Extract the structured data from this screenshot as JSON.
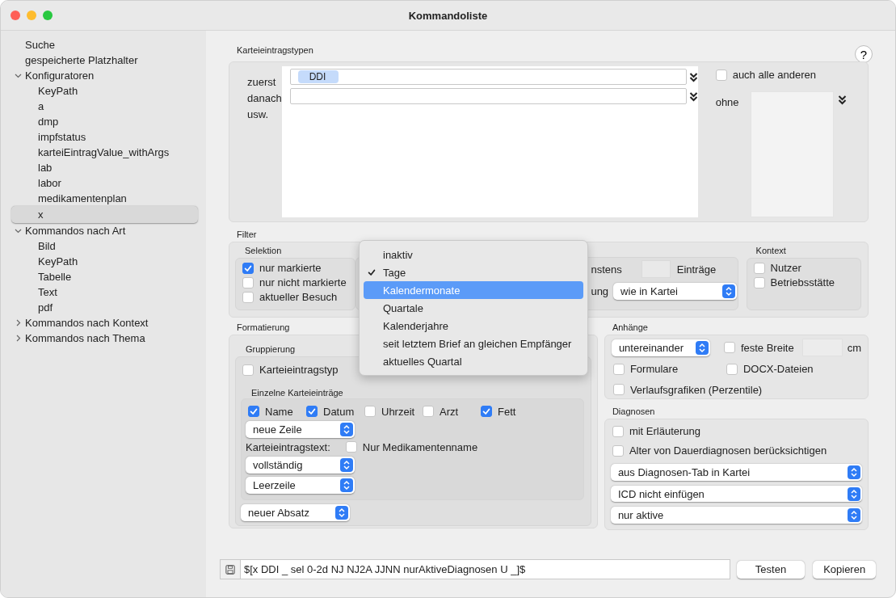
{
  "window": {
    "title": "Kommandoliste"
  },
  "sidebar": {
    "items": [
      {
        "kind": "leaf",
        "label": "Suche",
        "selected": false
      },
      {
        "kind": "leaf",
        "label": "gespeicherte Platzhalter",
        "selected": false
      },
      {
        "kind": "group",
        "label": "Konfiguratoren",
        "expanded": true,
        "selected": false,
        "children": [
          {
            "label": "KeyPath",
            "selected": false
          },
          {
            "label": "a",
            "selected": false
          },
          {
            "label": "dmp",
            "selected": false
          },
          {
            "label": "impfstatus",
            "selected": false
          },
          {
            "label": "karteiEintragValue_withArgs",
            "selected": false
          },
          {
            "label": "lab",
            "selected": false
          },
          {
            "label": "labor",
            "selected": false
          },
          {
            "label": "medikamentenplan",
            "selected": false
          },
          {
            "label": "x",
            "selected": true
          }
        ]
      },
      {
        "kind": "group",
        "label": "Kommandos nach Art",
        "expanded": true,
        "selected": false,
        "children": [
          {
            "label": "Bild",
            "selected": false
          },
          {
            "label": "KeyPath",
            "selected": false
          },
          {
            "label": "Tabelle",
            "selected": false
          },
          {
            "label": "Text",
            "selected": false
          },
          {
            "label": "pdf",
            "selected": false
          }
        ]
      },
      {
        "kind": "group",
        "label": "Kommandos nach Kontext",
        "expanded": false,
        "selected": false
      },
      {
        "kind": "group",
        "label": "Kommandos nach Thema",
        "expanded": false,
        "selected": false
      }
    ]
  },
  "help_button": {
    "label": "?"
  },
  "entry_types": {
    "title": "Karteieintragstypen",
    "row_labels": [
      "zuerst",
      "danach",
      "usw."
    ],
    "fields": [
      {
        "kind": "token",
        "token": "DDI"
      },
      {
        "kind": "empty"
      }
    ],
    "all_others": {
      "label": "auch alle anderen",
      "checked": false
    },
    "without_label": "ohne"
  },
  "filter": {
    "title": "Filter",
    "selection": {
      "title": "Selektion",
      "options": [
        {
          "label": "nur markierte",
          "checked": true
        },
        {
          "label": "nur nicht markierte",
          "checked": false
        },
        {
          "label": "aktueller Besuch",
          "checked": false
        }
      ]
    },
    "range": {
      "count_label": "nstens",
      "count_unit": "Einträge",
      "order_label": "ung",
      "order_value": "wie in Kartei"
    },
    "context": {
      "title": "Kontext",
      "options": [
        {
          "label": "Nutzer",
          "checked": false
        },
        {
          "label": "Betriebsstätte",
          "checked": false
        }
      ]
    }
  },
  "formatting": {
    "title": "Formatierung",
    "grouping": {
      "title": "Gruppierung",
      "option": {
        "label": "Karteieintragstyp",
        "checked": false
      },
      "entries": {
        "title": "Einzelne Karteieinträge",
        "options": [
          {
            "label": "Name",
            "checked": true
          },
          {
            "label": "Datum",
            "checked": true
          },
          {
            "label": "Uhrzeit",
            "checked": false
          },
          {
            "label": "Arzt",
            "checked": false
          },
          {
            "label": "Fett",
            "checked": true
          }
        ],
        "line_select": "neue Zeile",
        "text_label": "Karteieintragstext:",
        "medication_only": {
          "label": "Nur Medikamentenname",
          "checked": false
        },
        "text_select": "vollständig",
        "separator_select": "Leerzeile"
      },
      "paragraph_select": "neuer Absatz"
    }
  },
  "attachments": {
    "title": "Anhänge",
    "layout_select": "untereinander",
    "fixed_width": {
      "label": "feste Breite",
      "checked": false
    },
    "unit": "cm",
    "options": [
      {
        "label": "Formulare",
        "checked": false
      },
      {
        "label": "DOCX-Dateien",
        "checked": false
      },
      {
        "label": "Verlaufsgrafiken (Perzentile)",
        "checked": false
      }
    ]
  },
  "diagnoses": {
    "title": "Diagnosen",
    "options": [
      {
        "label": "mit Erläuterung",
        "checked": false
      },
      {
        "label": "Alter von Dauerdiagnosen berücksichtigen",
        "checked": false
      }
    ],
    "selects": [
      "aus Diagnosen-Tab in Kartei",
      "ICD nicht einfügen",
      "nur aktive"
    ]
  },
  "command_bar": {
    "value": "$[x DDI _ sel 0-2d NJ NJ2A JJNN nurAktiveDiagnosen U _]$",
    "buttons": [
      "Testen",
      "Kopieren"
    ]
  },
  "popup_menu": {
    "items": [
      {
        "label": "inaktiv",
        "checked": false,
        "selected": false
      },
      {
        "label": "Tage",
        "checked": true,
        "selected": false
      },
      {
        "label": "Kalendermonate",
        "checked": false,
        "selected": true
      },
      {
        "label": "Quartale",
        "checked": false,
        "selected": false
      },
      {
        "label": "Kalenderjahre",
        "checked": false,
        "selected": false
      },
      {
        "label": "seit letztem Brief an gleichen Empfänger",
        "checked": false,
        "selected": false
      },
      {
        "label": "aktuelles Quartal",
        "checked": false,
        "selected": false
      }
    ]
  }
}
